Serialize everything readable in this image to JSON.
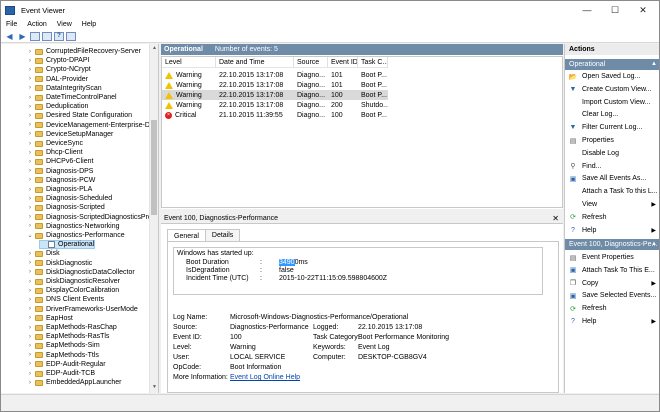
{
  "window": {
    "title": "Event Viewer",
    "minimize": "—",
    "maximize": "☐",
    "close": "✕"
  },
  "menu": [
    "File",
    "Action",
    "View",
    "Help"
  ],
  "tree": {
    "items": [
      {
        "label": "CorruptedFileRecovery-Server",
        "exp": "›"
      },
      {
        "label": "Crypto-DPAPI",
        "exp": "›"
      },
      {
        "label": "Crypto-NCrypt",
        "exp": "›"
      },
      {
        "label": "DAL-Provider",
        "exp": "›"
      },
      {
        "label": "DataIntegrityScan",
        "exp": "›"
      },
      {
        "label": "DateTimeControlPanel",
        "exp": "›"
      },
      {
        "label": "Deduplication",
        "exp": "›"
      },
      {
        "label": "Desired State Configuration",
        "exp": "›"
      },
      {
        "label": "DeviceManagement-Enterprise-Di",
        "exp": "›"
      },
      {
        "label": "DeviceSetupManager",
        "exp": "›"
      },
      {
        "label": "DeviceSync",
        "exp": "›"
      },
      {
        "label": "Dhcp-Client",
        "exp": "›"
      },
      {
        "label": "DHCPv6-Client",
        "exp": "›"
      },
      {
        "label": "Diagnosis-DPS",
        "exp": "›"
      },
      {
        "label": "Diagnosis-PCW",
        "exp": "›"
      },
      {
        "label": "Diagnosis-PLA",
        "exp": "›"
      },
      {
        "label": "Diagnosis-Scheduled",
        "exp": "›"
      },
      {
        "label": "Diagnosis-Scripted",
        "exp": "›"
      },
      {
        "label": "Diagnosis-ScriptedDiagnosticsPro",
        "exp": "›"
      },
      {
        "label": "Diagnostics-Networking",
        "exp": "›"
      },
      {
        "label": "Diagnostics-Performance",
        "exp": "⌄"
      },
      {
        "label": "Operational",
        "exp": ""
      },
      {
        "label": "Disk",
        "exp": "›"
      },
      {
        "label": "DiskDiagnostic",
        "exp": "›"
      },
      {
        "label": "DiskDiagnosticDataCollector",
        "exp": "›"
      },
      {
        "label": "DiskDiagnosticResolver",
        "exp": "›"
      },
      {
        "label": "DisplayColorCalibration",
        "exp": "›"
      },
      {
        "label": "DNS Client Events",
        "exp": "›"
      },
      {
        "label": "DriverFrameworks-UserMode",
        "exp": "›"
      },
      {
        "label": "EapHost",
        "exp": "›"
      },
      {
        "label": "EapMethods-RasChap",
        "exp": "›"
      },
      {
        "label": "EapMethods-RasTls",
        "exp": "›"
      },
      {
        "label": "EapMethods-Sim",
        "exp": "›"
      },
      {
        "label": "EapMethods-Ttls",
        "exp": "›"
      },
      {
        "label": "EDP-Audit-Regular",
        "exp": "›"
      },
      {
        "label": "EDP-Audit-TCB",
        "exp": "›"
      },
      {
        "label": "EmbeddedAppLauncher",
        "exp": "›"
      }
    ]
  },
  "log_header": {
    "name": "Operational",
    "count": "Number of events: 5"
  },
  "columns": [
    "Level",
    "Date and Time",
    "Source",
    "Event ID",
    "Task C..."
  ],
  "events": [
    {
      "level": "Warning",
      "date": "22.10.2015 13:17:08",
      "source": "Diagno...",
      "id": "101",
      "task": "Boot P..."
    },
    {
      "level": "Warning",
      "date": "22.10.2015 13:17:08",
      "source": "Diagno...",
      "id": "101",
      "task": "Boot P..."
    },
    {
      "level": "Warning",
      "date": "22.10.2015 13:17:08",
      "source": "Diagno...",
      "id": "100",
      "task": "Boot P..."
    },
    {
      "level": "Warning",
      "date": "22.10.2015 13:17:08",
      "source": "Diagno...",
      "id": "200",
      "task": "Shutdo..."
    },
    {
      "level": "Critical",
      "date": "21.10.2015 11:39:55",
      "source": "Diagno...",
      "id": "100",
      "task": "Boot P..."
    }
  ],
  "detail": {
    "title": "Event 100, Diagnostics-Performance",
    "tabs": [
      "General",
      "Details"
    ],
    "desc_head": "Windows has started up:",
    "desc_lines": [
      {
        "k": "Boot Duration",
        "sep": ":",
        "vhl": "3490",
        "v": "0ms"
      },
      {
        "k": "IsDegradation",
        "sep": ":",
        "vhl": "",
        "v": "false"
      },
      {
        "k": "Incident Time (UTC)",
        "sep": ":",
        "vhl": "",
        "v": "2015-10-22T11:15:09.598804600Z"
      }
    ],
    "props": {
      "log_name_k": "Log Name:",
      "log_name_v": "Microsoft-Windows-Diagnostics-Performance/Operational",
      "source_k": "Source:",
      "source_v": "Diagnostics-Performance",
      "logged_k": "Logged:",
      "logged_v": "22.10.2015 13:17:08",
      "eventid_k": "Event ID:",
      "eventid_v": "100",
      "taskcat_k": "Task Category:",
      "taskcat_v": "Boot Performance Monitoring",
      "level_k": "Level:",
      "level_v": "Warning",
      "keywords_k": "Keywords:",
      "keywords_v": "Event Log",
      "user_k": "User:",
      "user_v": "LOCAL SERVICE",
      "computer_k": "Computer:",
      "computer_v": "DESKTOP-CGB8GV4",
      "opcode_k": "OpCode:",
      "opcode_v": "Boot Information",
      "moreinfo_k": "More Information:",
      "moreinfo_v": "Event Log Online Help"
    }
  },
  "actions": {
    "title": "Actions",
    "section1": "Operational",
    "items1": [
      {
        "label": "Open Saved Log...",
        "icon": "📂",
        "color": "#d9a520",
        "sub": ""
      },
      {
        "label": "Create Custom View...",
        "icon": "▼",
        "color": "#2a64a8",
        "sub": ""
      },
      {
        "label": "Import Custom View...",
        "icon": "",
        "color": "#2a64a8",
        "sub": ""
      },
      {
        "label": "Clear Log...",
        "icon": "",
        "color": "#2a64a8",
        "sub": ""
      },
      {
        "label": "Filter Current Log...",
        "icon": "▼",
        "color": "#2a64a8",
        "sub": ""
      },
      {
        "label": "Properties",
        "icon": "▤",
        "color": "#555",
        "sub": ""
      },
      {
        "label": "Disable Log",
        "icon": "",
        "color": "#555",
        "sub": ""
      },
      {
        "label": "Find...",
        "icon": "⚲",
        "color": "#555",
        "sub": ""
      },
      {
        "label": "Save All Events As...",
        "icon": "▣",
        "color": "#2a64a8",
        "sub": ""
      },
      {
        "label": "Attach a Task To this L...",
        "icon": "",
        "color": "#555",
        "sub": ""
      },
      {
        "label": "View",
        "icon": "",
        "color": "#555",
        "sub": "▶"
      },
      {
        "label": "Refresh",
        "icon": "⟳",
        "color": "#2a9a3a",
        "sub": ""
      },
      {
        "label": "Help",
        "icon": "?",
        "color": "#2a64a8",
        "sub": "▶"
      }
    ],
    "section2": "Event 100, Diagnostics-Pe...",
    "items2": [
      {
        "label": "Event Properties",
        "icon": "▤",
        "color": "#555",
        "sub": ""
      },
      {
        "label": "Attach Task To This E...",
        "icon": "▣",
        "color": "#2a64a8",
        "sub": ""
      },
      {
        "label": "Copy",
        "icon": "❐",
        "color": "#555",
        "sub": "▶"
      },
      {
        "label": "Save Selected Events...",
        "icon": "▣",
        "color": "#2a64a8",
        "sub": ""
      },
      {
        "label": "Refresh",
        "icon": "⟳",
        "color": "#2a9a3a",
        "sub": ""
      },
      {
        "label": "Help",
        "icon": "?",
        "color": "#2a64a8",
        "sub": "▶"
      }
    ]
  }
}
